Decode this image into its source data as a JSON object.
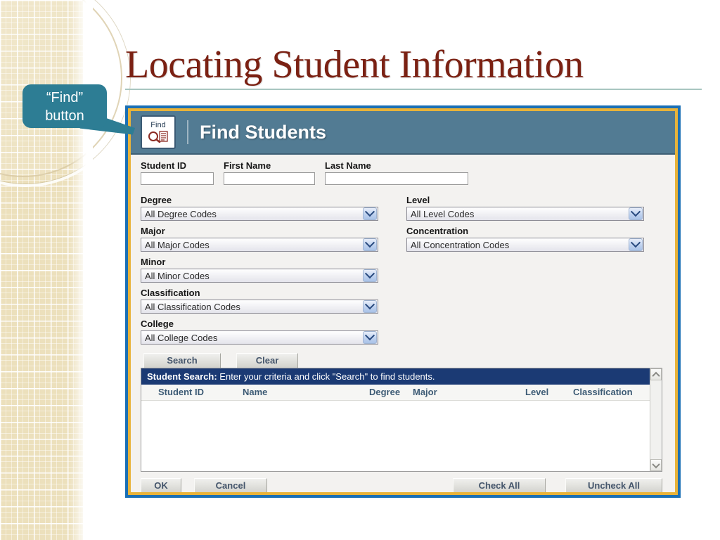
{
  "slide": {
    "title": "Locating Student Information"
  },
  "callout": {
    "line1": "“Find”",
    "line2": "button",
    "color": "#2d7d94"
  },
  "window": {
    "border_outer_color": "#1a6fb5",
    "border_inner_color": "#e8b33a",
    "header": {
      "icon_label": "Find",
      "icon_name": "find-magnifier-icon",
      "title": "Find Students",
      "bar_color": "#527b93"
    },
    "name_fields": [
      {
        "label": "Student ID",
        "value": "",
        "placeholder": ""
      },
      {
        "label": "First Name",
        "value": "",
        "placeholder": ""
      },
      {
        "label": "Last Name",
        "value": "",
        "placeholder": ""
      }
    ],
    "code_selects_left": [
      {
        "label": "Degree",
        "value": "All Degree Codes"
      },
      {
        "label": "Major",
        "value": "All Major Codes"
      },
      {
        "label": "Minor",
        "value": "All Minor Codes"
      },
      {
        "label": "Classification",
        "value": "All Classification Codes"
      },
      {
        "label": "College",
        "value": "All College Codes"
      }
    ],
    "code_selects_right": [
      {
        "label": "Level",
        "value": "All Level Codes"
      },
      {
        "label": "Concentration",
        "value": "All Concentration Codes"
      }
    ],
    "actions": {
      "search": "Search",
      "clear": "Clear"
    },
    "results": {
      "banner_bold": "Student Search:",
      "banner_text": " Enter your criteria and click \"Search\" to find students.",
      "banner_color": "#1b3a74",
      "columns": [
        "Student ID",
        "Name",
        "Degree",
        "Major",
        "Level",
        "Classification"
      ],
      "rows": []
    },
    "footer": {
      "ok": "OK",
      "cancel": "Cancel",
      "check_all": "Check All",
      "uncheck_all": "Uncheck All"
    }
  }
}
